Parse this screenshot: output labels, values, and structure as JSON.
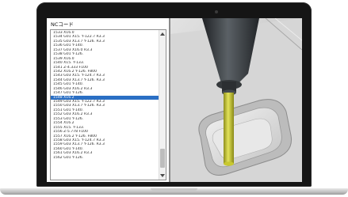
{
  "window": {
    "title": "NCコード"
  },
  "nc_code": {
    "lines": [
      "1533 X16.0",
      "1534 G01 X15. Y-122.7 R3.3",
      "1535 G03 X13.7 Y-126. R3.3",
      "1536 G01 Y-140.",
      "1537 G03 X16.0 R3.3",
      "1538 G01 Y-126.",
      "1539 X16.0",
      "1540 X15. Y-133.",
      "1541 Z-4.333 F100",
      "1542 X16.2 Y-126. F800",
      "1543 G03 X15. Y-124.7 R3.3",
      "1544 G03 X13.7 Y-126. R3.3",
      "1545 G01 Y-140.",
      "1546 G03 X16.2 R3.3",
      "1547 G01 Y-126.",
      "1548 X16.2",
      "1549 G03 X15. Y-122.7 R3.3",
      "1550 G03 X13.7 Y-126. R3.3",
      "1551 G01 Y-140.",
      "1552 G03 X16.2 R3.3",
      "1553 G01 Y-126.",
      "1554 X16.2",
      "1555 X15. Y-133.",
      "1556 Z-5.778 F100",
      "1557 X16.2 Y-126. F800",
      "1558 G03 X15. Y-124.7 R3.3",
      "1559 G03 X13.7 Y-126. R3.3",
      "1560 G01 Y-140.",
      "1561 G03 X16.2 R3.3",
      "1562 G01 Y-126."
    ],
    "selected_index": 15
  },
  "colors": {
    "selection": "#2a6fc4",
    "tool_bit": "#c9c931",
    "holder": "#3f4347",
    "workpiece": "#d8d8d8"
  },
  "icons": {
    "scroll_up": "triangle-up",
    "scroll_down": "triangle-down"
  }
}
